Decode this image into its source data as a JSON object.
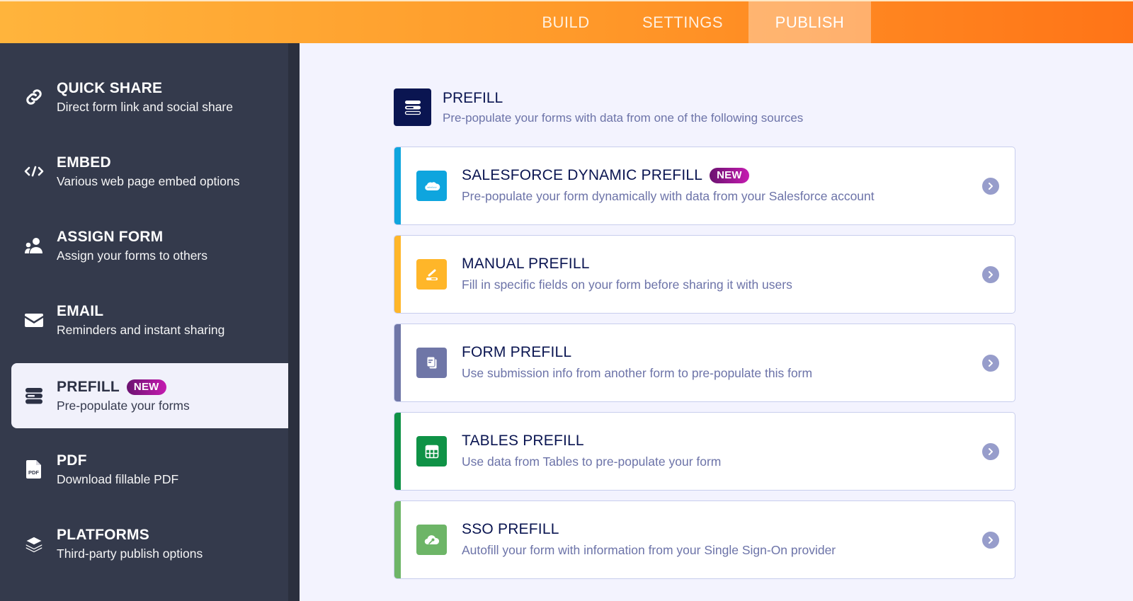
{
  "topbar": {
    "tabs": [
      {
        "label": "BUILD",
        "active": false
      },
      {
        "label": "SETTINGS",
        "active": false
      },
      {
        "label": "PUBLISH",
        "active": true
      }
    ]
  },
  "sidebar": {
    "items": [
      {
        "title": "QUICK SHARE",
        "subtitle": "Direct form link and social share",
        "icon": "link-icon",
        "active": false
      },
      {
        "title": "EMBED",
        "subtitle": "Various web page embed options",
        "icon": "code-icon",
        "active": false
      },
      {
        "title": "ASSIGN FORM",
        "subtitle": "Assign your forms to others",
        "icon": "users-icon",
        "active": false
      },
      {
        "title": "EMAIL",
        "subtitle": "Reminders and instant sharing",
        "icon": "envelope-icon",
        "active": false
      },
      {
        "title": "PREFILL",
        "subtitle": "Pre-populate your forms",
        "icon": "prefill-icon",
        "active": true,
        "badge": "NEW"
      },
      {
        "title": "PDF",
        "subtitle": "Download fillable PDF",
        "icon": "pdf-icon",
        "active": false
      },
      {
        "title": "PLATFORMS",
        "subtitle": "Third-party publish options",
        "icon": "layers-icon",
        "active": false
      }
    ]
  },
  "main": {
    "header": {
      "title": "PREFILL",
      "subtitle": "Pre-populate your forms with data from one of the following sources"
    },
    "cards": [
      {
        "title": "SALESFORCE DYNAMIC PREFILL",
        "badge": "NEW",
        "description": "Pre-populate your form dynamically with data from your Salesforce account",
        "icon": "salesforce-icon",
        "accent": "#0ea5de",
        "icon_bg": "#0ea5de"
      },
      {
        "title": "MANUAL PREFILL",
        "description": "Fill in specific fields on your form before sharing it with users",
        "icon": "pencil-icon",
        "accent": "#ffb629",
        "icon_bg": "#ffb629"
      },
      {
        "title": "FORM PREFILL",
        "description": "Use submission info from another form to pre-populate this form",
        "icon": "documents-icon",
        "accent": "#6f76a7",
        "icon_bg": "#6f76a7"
      },
      {
        "title": "TABLES PREFILL",
        "description": "Use data from Tables to pre-populate your form",
        "icon": "table-grid-icon",
        "accent": "#0f9246",
        "icon_bg": "#0f9246"
      },
      {
        "title": "SSO PREFILL",
        "description": "Autofill your form with information from your Single Sign-On provider",
        "icon": "cloud-key-icon",
        "accent": "#6db567",
        "icon_bg": "#6db567"
      }
    ]
  }
}
